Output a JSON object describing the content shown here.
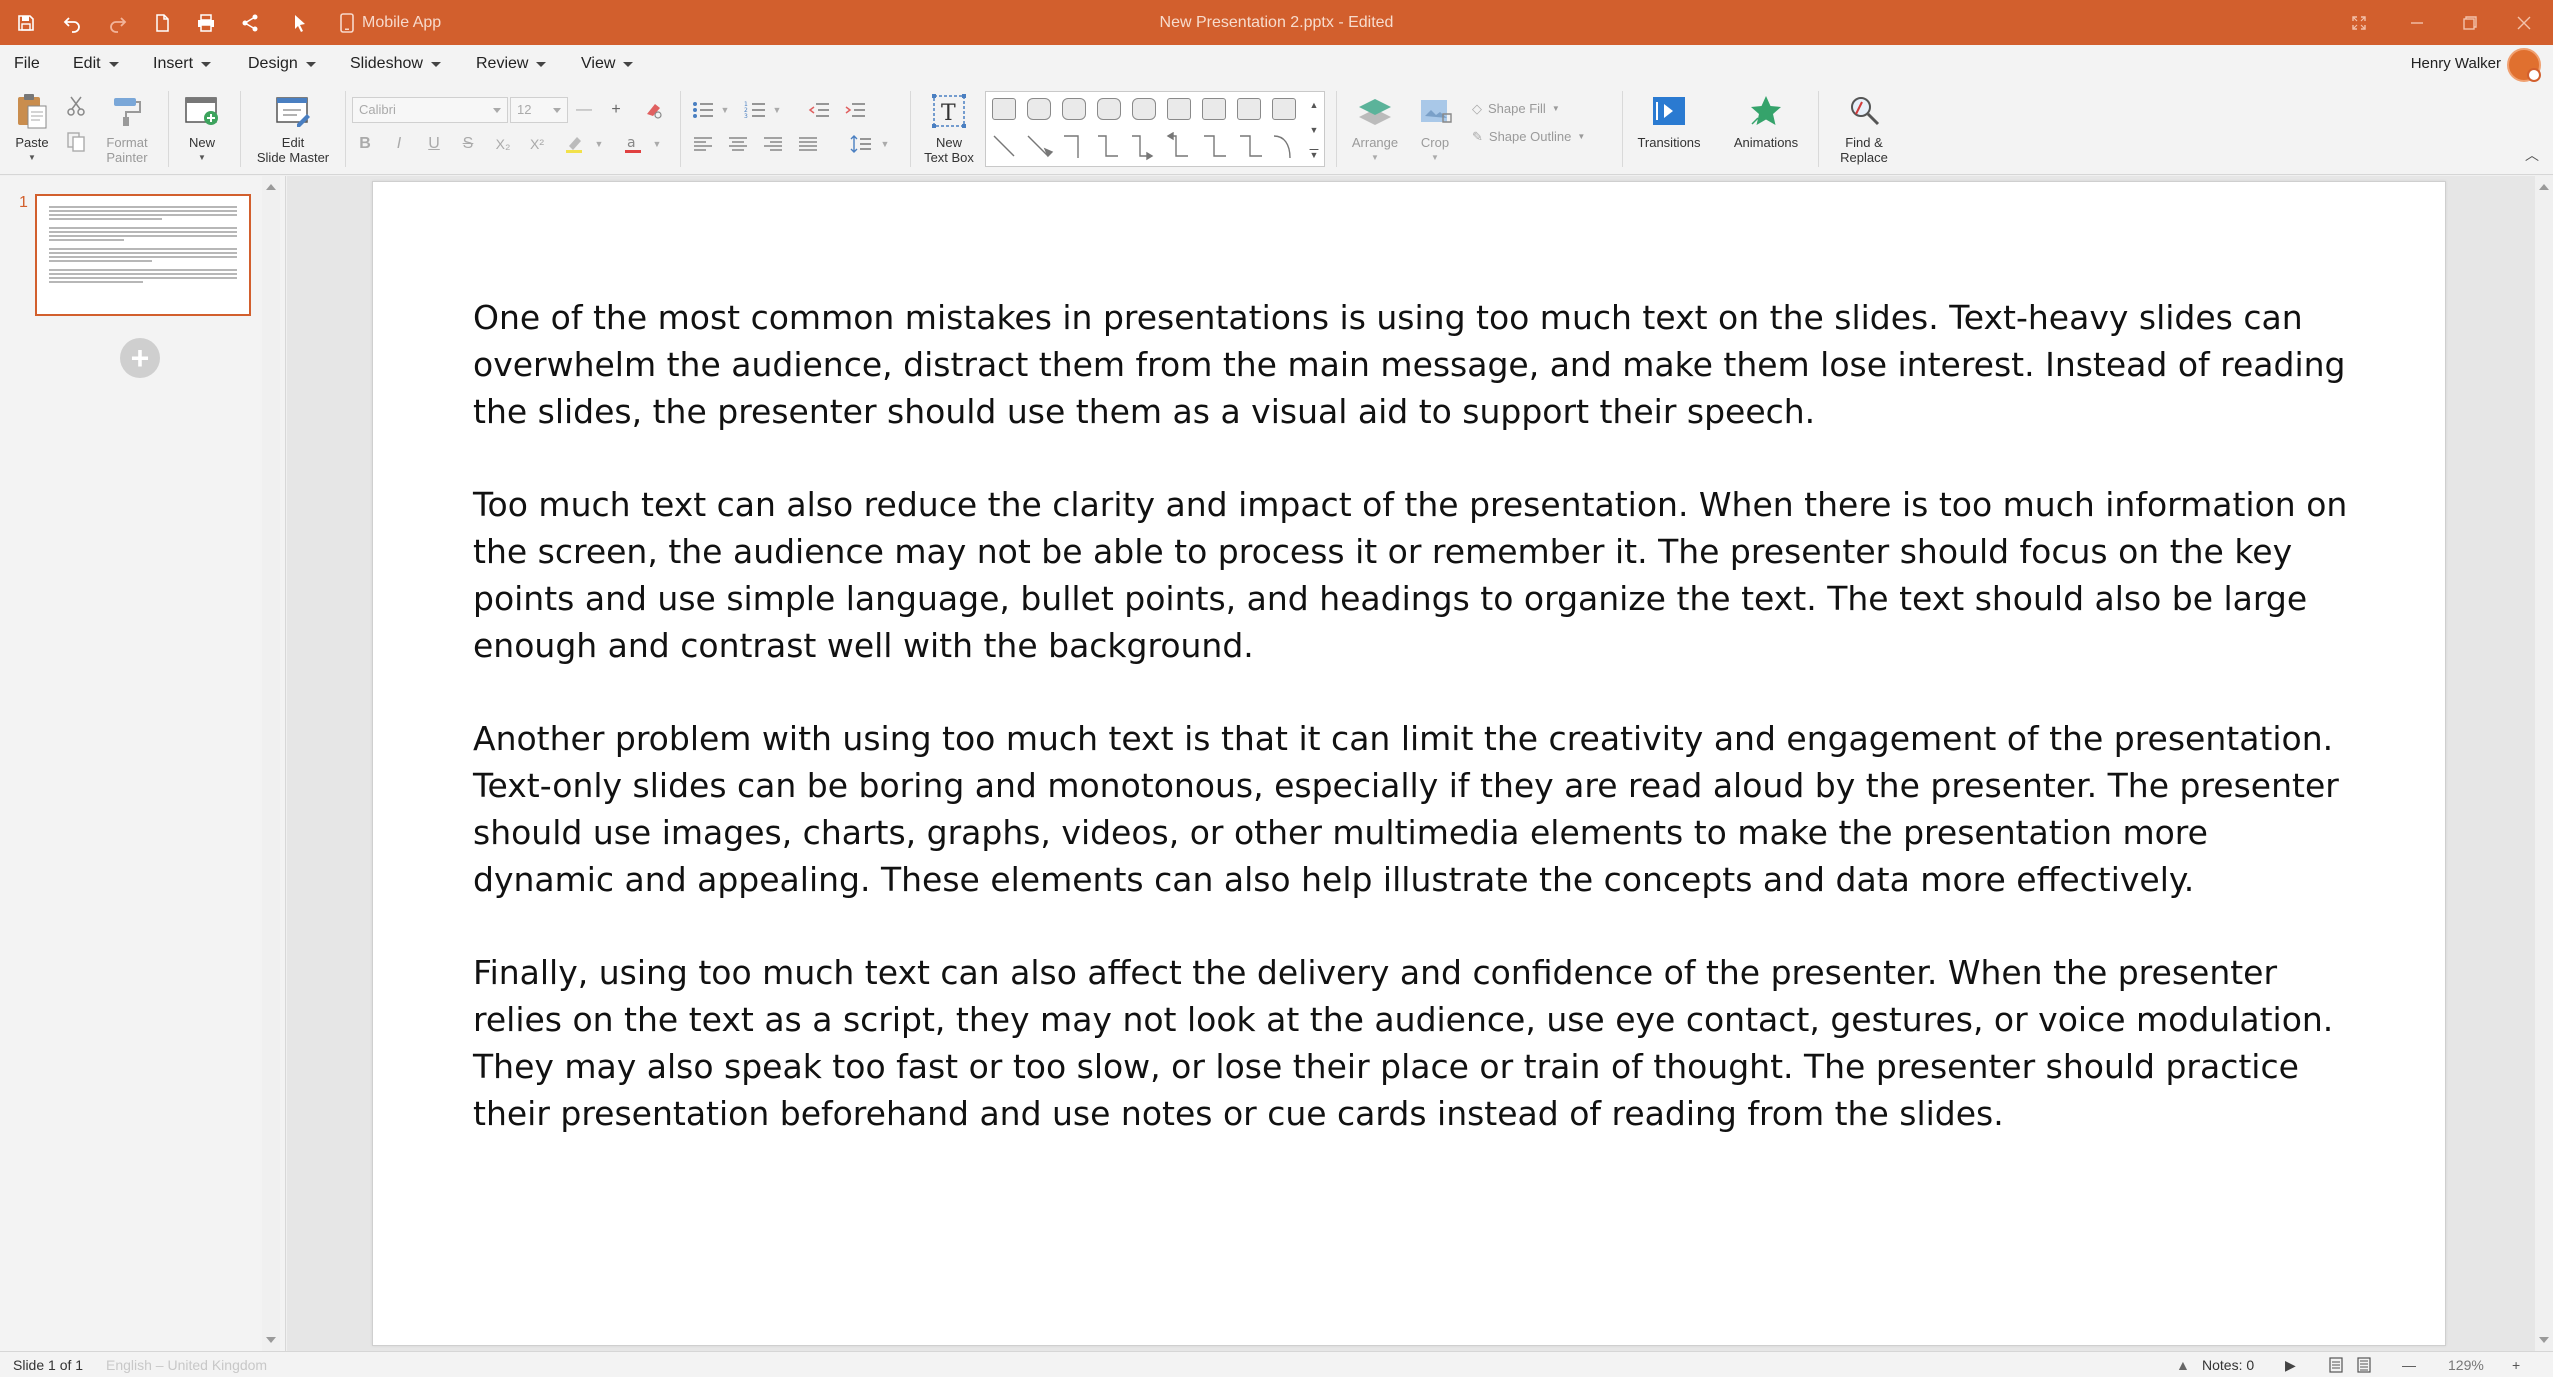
{
  "app": {
    "window_title": "New Presentation 2.pptx - Edited",
    "mobile_app_label": "Mobile App"
  },
  "menu": {
    "items": [
      {
        "label": "File",
        "has_caret": false
      },
      {
        "label": "Edit",
        "has_caret": true
      },
      {
        "label": "Insert",
        "has_caret": true
      },
      {
        "label": "Design",
        "has_caret": true
      },
      {
        "label": "Slideshow",
        "has_caret": true
      },
      {
        "label": "Review",
        "has_caret": true
      },
      {
        "label": "View",
        "has_caret": true
      }
    ],
    "user_name": "Henry Walker"
  },
  "ribbon": {
    "paste": "Paste",
    "format_painter": "Format\nPainter",
    "new": "New",
    "edit_slide_master": "Edit\nSlide Master",
    "font_name": "Calibri",
    "font_size": "12",
    "new_text_box": "New\nText Box",
    "arrange": "Arrange",
    "crop": "Crop",
    "shape_fill": "Shape Fill",
    "shape_outline": "Shape Outline",
    "transitions": "Transitions",
    "animations": "Animations",
    "find_replace": "Find &\nReplace"
  },
  "thumbnails": {
    "slide_number": "1"
  },
  "slide": {
    "paragraphs": [
      "One of the most common mistakes in presentations is using too much text on the slides. Text-heavy slides can overwhelm the audience, distract them from the main message, and make them lose interest. Instead of reading the slides, the presenter should use them as a visual aid to support their speech.",
      "Too much text can also reduce the clarity and impact of the presentation. When there is too much information on the screen, the audience may not be able to process it or remember it. The presenter should focus on the key points and use simple language, bullet points, and headings to organize the text. The text should also be large enough and contrast well with the background.",
      "Another problem with using too much text is that it can limit the creativity and engagement of the presentation. Text-only slides can be boring and monotonous, especially if they are read aloud by the presenter. The presenter should use images, charts, graphs, videos, or other multimedia elements to make the presentation more dynamic and appealing. These elements can also help illustrate the concepts and data more effectively.",
      "Finally, using too much text can also affect the delivery and confidence of the presenter. When the presenter relies on the text as a script, they may not look at the audience, use eye contact, gestures, or voice modulation. They may also speak too fast or too slow, or lose their place or train of thought. The presenter should practice their presentation beforehand and use notes or cue cards instead of reading from the slides."
    ]
  },
  "status": {
    "slide_counter": "Slide 1 of 1",
    "language": "English – United Kingdom",
    "notes": "Notes: 0",
    "zoom": "129%"
  },
  "colors": {
    "accent": "#d25f2d",
    "ribbon_bg": "#f3f3f3",
    "canvas_bg": "#e6e6e6"
  }
}
